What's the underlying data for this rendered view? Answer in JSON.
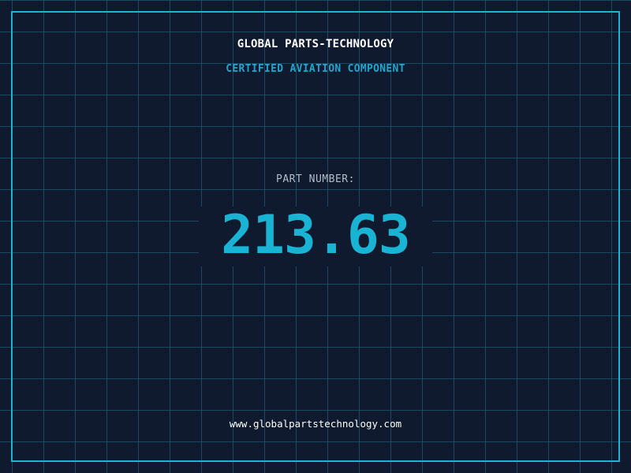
{
  "header": {
    "company_name": "GLOBAL PARTS-TECHNOLOGY",
    "tagline": "CERTIFIED AVIATION COMPONENT"
  },
  "part": {
    "label": "PART NUMBER:",
    "number": "213.63"
  },
  "footer": {
    "website": "www.globalpartstechnology.com"
  },
  "colors": {
    "background": "#0f1a2e",
    "accent": "#19b3d4",
    "grid": "#266e8c",
    "title": "#ffffff",
    "label": "#b3bccb"
  }
}
